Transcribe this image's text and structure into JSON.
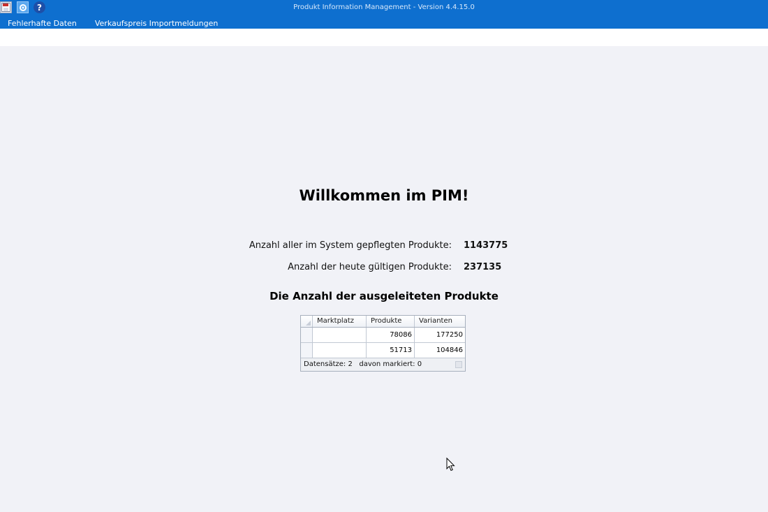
{
  "titlebar": {
    "title": "Produkt Information Management - Version 4.4.15.0",
    "icons": [
      "save-icon",
      "settings-icon",
      "help-icon"
    ],
    "help_glyph": "?"
  },
  "menu": {
    "items": [
      {
        "label": "Fehlerhafte Daten"
      },
      {
        "label": "Verkaufspreis Importmeldungen"
      }
    ]
  },
  "main": {
    "welcome": "Willkommen im PIM!",
    "stats": [
      {
        "label": "Anzahl aller im System gepflegten Produkte:",
        "value": "1143775"
      },
      {
        "label": "Anzahl der heute gültigen Produkte:",
        "value": "237135"
      }
    ],
    "export_heading": "Die Anzahl der ausgeleiteten Produkte"
  },
  "grid": {
    "columns": [
      "Marktplatz",
      "Produkte",
      "Varianten"
    ],
    "rows": [
      {
        "marktplatz": "",
        "produkte": "78086",
        "varianten": "177250"
      },
      {
        "marktplatz": "",
        "produkte": "51713",
        "varianten": "104846"
      }
    ],
    "footer_records_label": "Datensätze:",
    "footer_records_value": "2",
    "footer_marked_label": "davon markiert:",
    "footer_marked_value": "0"
  },
  "colors": {
    "titlebar_bg": "#0e6fcf",
    "page_bg": "#f1f2f7"
  }
}
